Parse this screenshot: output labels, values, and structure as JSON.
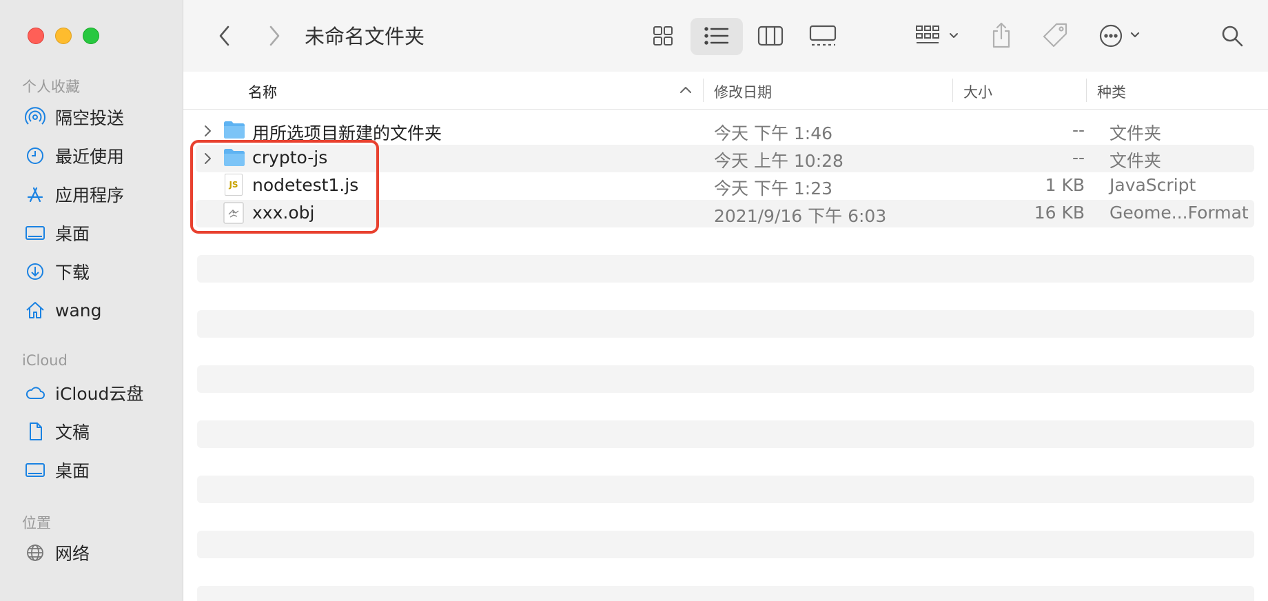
{
  "sidebar": {
    "favorites_title": "个人收藏",
    "favorites": [
      {
        "label": "隔空投送",
        "icon": "airdrop-icon"
      },
      {
        "label": "最近使用",
        "icon": "clock-icon"
      },
      {
        "label": "应用程序",
        "icon": "applications-icon"
      },
      {
        "label": "桌面",
        "icon": "desktop-icon"
      },
      {
        "label": "下载",
        "icon": "download-icon"
      },
      {
        "label": "wang",
        "icon": "home-icon"
      }
    ],
    "icloud_title": "iCloud",
    "icloud": [
      {
        "label": "iCloud云盘",
        "icon": "cloud-icon"
      },
      {
        "label": "文稿",
        "icon": "document-icon"
      },
      {
        "label": "桌面",
        "icon": "desktop-icon"
      }
    ],
    "locations_title": "位置",
    "locations": [
      {
        "label": "网络",
        "icon": "globe-icon"
      }
    ]
  },
  "toolbar": {
    "title": "未命名文件夹"
  },
  "columns": {
    "name": "名称",
    "date": "修改日期",
    "size": "大小",
    "kind": "种类"
  },
  "files": [
    {
      "name": "用所选项目新建的文件夹",
      "date": "今天 下午 1:46",
      "size": "--",
      "kind": "文件夹",
      "icon": "folder-icon"
    },
    {
      "name": "crypto-js",
      "date": "今天 上午 10:28",
      "size": "--",
      "kind": "文件夹",
      "icon": "folder-icon"
    },
    {
      "name": "nodetest1.js",
      "date": "今天 下午 1:23",
      "size": "1 KB",
      "kind": "JavaScript",
      "icon": "js-file-icon",
      "icon_text": "JS"
    },
    {
      "name": "xxx.obj",
      "date": "2021/9/16 下午 6:03",
      "size": "16 KB",
      "kind": "Geome...Format",
      "icon": "obj-file-icon"
    }
  ],
  "colors": {
    "accent": "#1a82e2",
    "highlight": "#e8412f",
    "folder": "#5eb3f2"
  }
}
